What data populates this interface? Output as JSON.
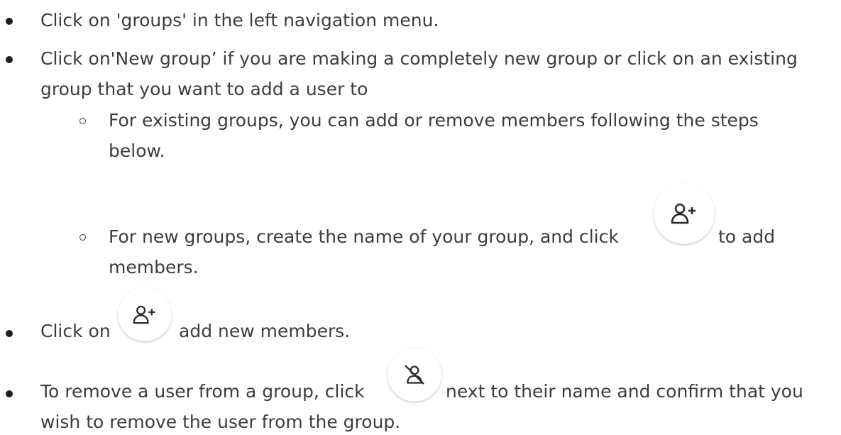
{
  "steps": [
    {
      "text": "Click on 'groups' in the left navigation menu."
    },
    {
      "line1": "Click on'New group’ if you are making a completely new group or click on an existing",
      "line2": "group that you want to add a user to",
      "substeps": [
        {
          "line1": "For existing groups, you can add or remove members following the steps",
          "line2": "below."
        },
        {
          "before_icon": "For new groups, create the name of your group, and click",
          "icon": "add-user-icon",
          "after_icon": "to add",
          "line2": "members."
        }
      ]
    },
    {
      "before_icon": "Click on",
      "icon": "add-user-icon",
      "after_icon": "add new members."
    },
    {
      "before_icon": "To remove a user from a group, click",
      "icon": "remove-user-icon",
      "after_icon": "next to their name and confirm that you",
      "line2": "wish to remove the user from the group."
    }
  ],
  "colors": {
    "text": "#3d3d3d",
    "bullet": "#1e1e1e",
    "icon_stroke": "#2b2b2b"
  }
}
